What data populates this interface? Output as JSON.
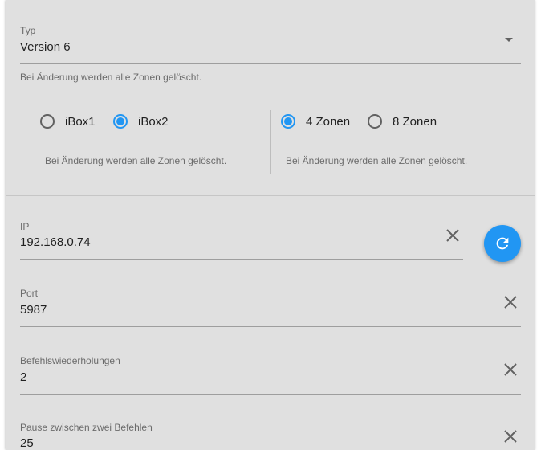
{
  "typ": {
    "label": "Typ",
    "value": "Version 6",
    "helper": "Bei Änderung werden alle Zonen gelöscht."
  },
  "ibox_group": {
    "options": [
      {
        "label": "iBox1",
        "checked": false
      },
      {
        "label": "iBox2",
        "checked": true
      }
    ],
    "helper": "Bei Änderung werden alle Zonen gelöscht."
  },
  "zones_group": {
    "options": [
      {
        "label": "4 Zonen",
        "checked": true
      },
      {
        "label": "8 Zonen",
        "checked": false
      }
    ],
    "helper": "Bei Änderung werden alle Zonen gelöscht."
  },
  "ip": {
    "label": "IP",
    "value": "192.168.0.74"
  },
  "port": {
    "label": "Port",
    "value": "5987"
  },
  "repeats": {
    "label": "Befehlswiederholungen",
    "value": "2"
  },
  "pause": {
    "label": "Pause zwischen zwei Befehlen",
    "value": "25"
  },
  "colors": {
    "accent": "#2196f3",
    "background": "#e0e0e0"
  }
}
